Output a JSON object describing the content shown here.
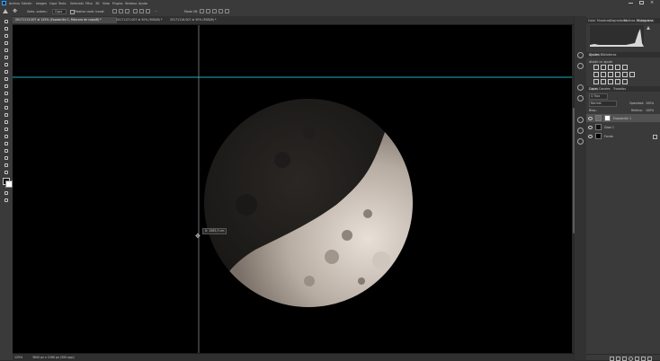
{
  "app": {
    "accent_color": "#1473e6",
    "guide_color": "#1ab3c1"
  },
  "menubar": {
    "icon": "ps-logo-icon",
    "items": [
      "Archivo",
      "Edición",
      "Imagen",
      "Capa",
      "Texto",
      "Selección",
      "Filtro",
      "3D",
      "Vista",
      "Plugins",
      "Ventana",
      "Ayuda"
    ],
    "window_controls": [
      "minimize-icon",
      "maximize-icon",
      "close-icon"
    ]
  },
  "options_bar": {
    "home_icon": "home-icon",
    "tool_icon": "move-tool-icon",
    "auto_select_label": "Selec. autom.:",
    "auto_select_value": "Capa",
    "transform_label": "Mostrar contr. transf.",
    "mode_3d": "Modo 3D:",
    "extra_label": "···"
  },
  "tabs": [
    {
      "label": "20171113-007 al 125% (Exposición 1, Máscara de capa/8) *",
      "active": true
    },
    {
      "label": "20171127-007 al 50% (RGB/8) *",
      "active": false
    },
    {
      "label": "20171116-007 al 50% (RGB/8) *",
      "active": false
    }
  ],
  "canvas": {
    "tooltip": "X: 1983,3 cm",
    "background": "#000000"
  },
  "statusbar": {
    "zoom": "125%",
    "doc_info": "3840 px x 2160 px (300 ppp)"
  },
  "panels": {
    "top_tabs": [
      "Color",
      "Muestras",
      "Degradados",
      "Motivos",
      "Histograma"
    ],
    "top_active": "Histograma",
    "mid_tabs": [
      "Ajustes",
      "Bibliotecas"
    ],
    "mid_active": "Ajustes",
    "adjustments_label": "Añadir un ajuste",
    "layer_tabs": [
      "Capas",
      "Canales",
      "Trazados"
    ],
    "layer_active": "Capas",
    "kind_label": "Q Tipo",
    "blend_mode": "Normal",
    "opacity_label": "Opacidad:",
    "opacity_value": "100%",
    "lock_label": "Bloq.:",
    "fill_label": "Relleno:",
    "fill_value": "100%",
    "layers": [
      {
        "name": "Exposición 1",
        "selected": true,
        "type": "adjustment"
      },
      {
        "name": "Glow 1",
        "selected": false,
        "type": "image"
      },
      {
        "name": "Fondo",
        "selected": false,
        "type": "background"
      }
    ]
  }
}
